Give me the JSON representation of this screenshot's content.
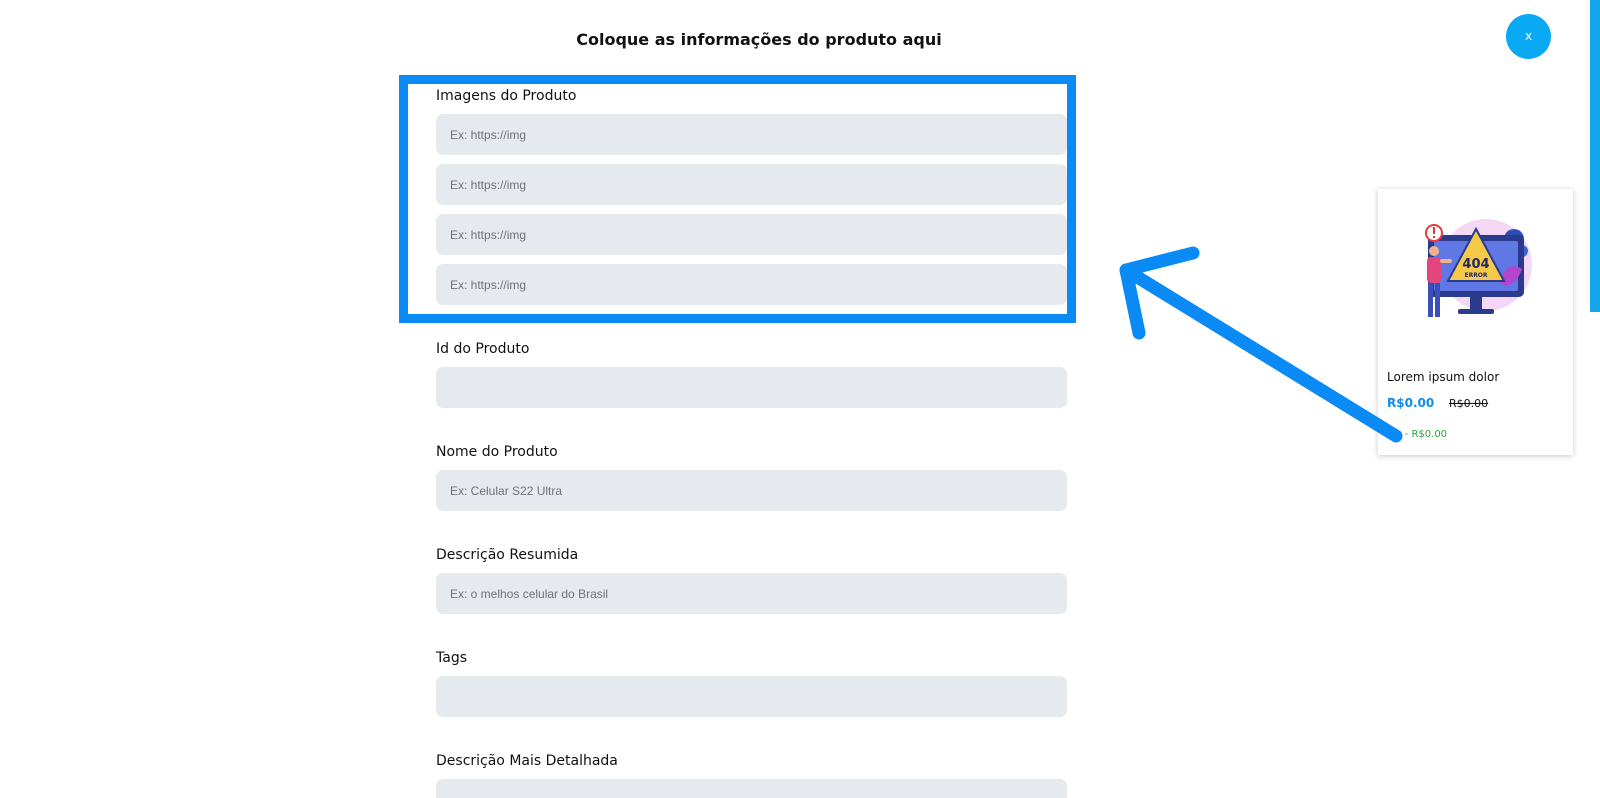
{
  "form": {
    "title": "Coloque as informações do produto aqui",
    "close_label": "x",
    "images": {
      "label": "Imagens do Produto",
      "inputs": [
        {
          "value": "",
          "placeholder": "Ex: https://img"
        },
        {
          "value": "",
          "placeholder": "Ex: https://img"
        },
        {
          "value": "",
          "placeholder": "Ex: https://img"
        },
        {
          "value": "",
          "placeholder": "Ex: https://img"
        }
      ]
    },
    "product_id": {
      "label": "Id do Produto",
      "value": "",
      "placeholder": ""
    },
    "product_name": {
      "label": "Nome do Produto",
      "value": "",
      "placeholder": "Ex: Celular S22 Ultra"
    },
    "short_description": {
      "label": "Descrição Resumida",
      "value": "",
      "placeholder": "Ex: o melhos celular do Brasil"
    },
    "tags": {
      "label": "Tags",
      "value": "",
      "placeholder": ""
    },
    "detailed_description": {
      "label": "Descrição Mais Detalhada",
      "value": "",
      "placeholder": ""
    }
  },
  "preview_card": {
    "title": "Lorem ipsum dolor",
    "price": "R$0.00",
    "old_price": "R$0.00",
    "pix_text": "Pix - R$0.00",
    "image_icon": "404-error-illustration",
    "image_text": "404",
    "image_subtext": "ERROR"
  },
  "annotation": {
    "highlight_color": "#0a8af5",
    "arrow_color": "#0a8af5"
  },
  "colors": {
    "accent": "#0aa9f4",
    "input_background": "#e6eaee",
    "price": "#0d8cf2",
    "pix": "#22a836"
  }
}
